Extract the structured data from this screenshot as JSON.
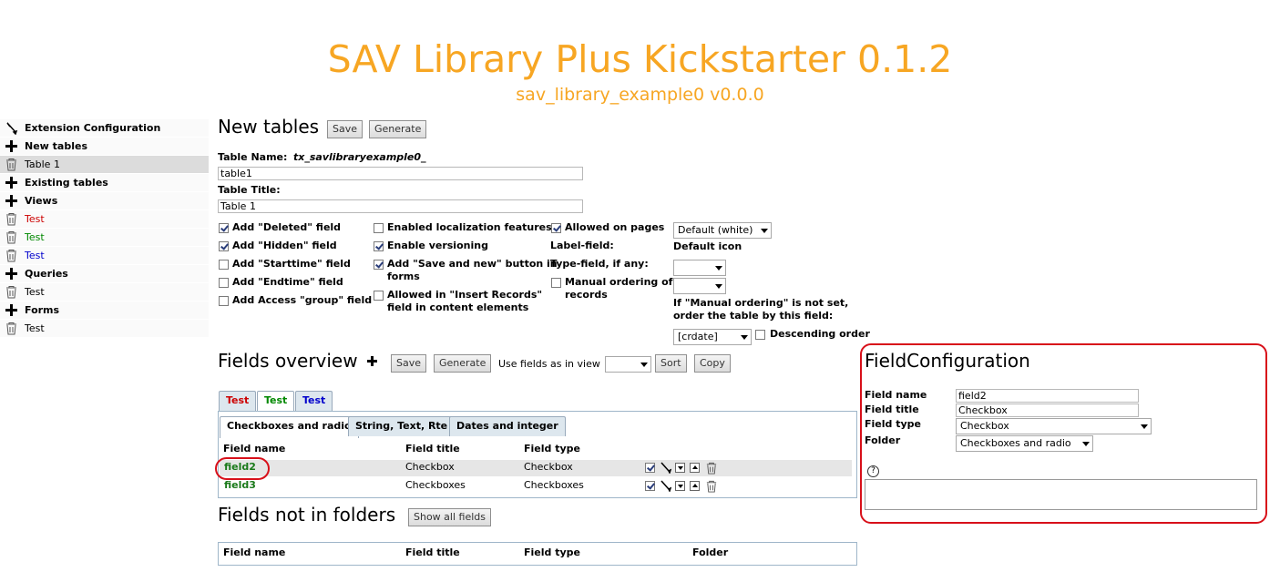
{
  "header": {
    "title": "SAV Library Plus Kickstarter 0.1.2",
    "subtitle": "sav_library_example0 v0.0.0"
  },
  "sidebar": {
    "items": [
      {
        "label": "Extension Configuration",
        "icon": "edit-icon"
      },
      {
        "label": "New tables",
        "icon": "plus-icon"
      },
      {
        "label": "Table 1",
        "icon": "trash-icon"
      },
      {
        "label": "Existing tables",
        "icon": "plus-icon"
      },
      {
        "label": "Views",
        "icon": "plus-icon"
      },
      {
        "label": "Test",
        "icon": "trash-icon",
        "color": "#cc0000"
      },
      {
        "label": "Test",
        "icon": "trash-icon",
        "color": "#008800"
      },
      {
        "label": "Test",
        "icon": "trash-icon",
        "color": "#0000cc"
      },
      {
        "label": "Queries",
        "icon": "plus-icon"
      },
      {
        "label": "Test",
        "icon": "trash-icon"
      },
      {
        "label": "Forms",
        "icon": "plus-icon"
      },
      {
        "label": "Test",
        "icon": "trash-icon"
      }
    ]
  },
  "new_tables": {
    "heading": "New tables",
    "save_label": "Save",
    "generate_label": "Generate",
    "table_name_label": "Table Name:",
    "table_name_prefix": "tx_savlibraryexample0_",
    "table_name_value": "table1",
    "table_title_label": "Table Title:",
    "table_title_value": "Table 1",
    "options_col1": [
      {
        "label": "Add \"Deleted\" field",
        "checked": true
      },
      {
        "label": "Add \"Hidden\" field",
        "checked": true
      },
      {
        "label": "Add \"Starttime\" field",
        "checked": false
      },
      {
        "label": "Add \"Endtime\" field",
        "checked": false
      },
      {
        "label": "Add Access \"group\" field",
        "checked": false
      }
    ],
    "options_col2": [
      {
        "label": "Enabled localization features",
        "checked": false
      },
      {
        "label": "Enable versioning",
        "checked": true
      },
      {
        "label": "Add \"Save and new\" button in",
        "label2": "forms",
        "checked": true
      },
      {
        "label": "Allowed in \"Insert Records\"",
        "label2": "field in content elements",
        "checked": false
      }
    ],
    "allowed_on_pages_label": "Allowed on pages",
    "label_field_label": "Label-field:",
    "type_field_label": "Type-field, if any:",
    "manual_ordering_label": "Manual ordering of",
    "manual_ordering_label2": "records",
    "page_type_select": "Default (white)",
    "default_icon_label": "Default icon",
    "ordering_note_1": "If \"Manual ordering\" is not set,",
    "ordering_note_2": "order the table by this field:",
    "order_field_select": "[crdate]",
    "descending_label": "Descending order"
  },
  "fields_overview": {
    "heading": "Fields overview",
    "save_label": "Save",
    "generate_label": "Generate",
    "use_fields_label": "Use fields as in view",
    "use_fields_select": "",
    "sort_label": "Sort",
    "copy_label": "Copy",
    "view_tabs": [
      {
        "label": "Test",
        "color": "#cc0000"
      },
      {
        "label": "Test",
        "color": "#008800"
      },
      {
        "label": "Test",
        "color": "#0000cc"
      }
    ],
    "folder_tabs": [
      {
        "label": "Checkboxes and radio"
      },
      {
        "label": "String, Text, Rte"
      },
      {
        "label": "Dates and integer"
      }
    ],
    "columns": {
      "name": "Field name",
      "title": "Field title",
      "type": "Field type"
    },
    "rows": [
      {
        "name": "field2",
        "title": "Checkbox",
        "type": "Checkbox"
      },
      {
        "name": "field3",
        "title": "Checkboxes",
        "type": "Checkboxes"
      }
    ]
  },
  "fields_not_in_folders": {
    "heading": "Fields not in folders",
    "show_all_label": "Show all fields",
    "columns": {
      "name": "Field name",
      "title": "Field title",
      "type": "Field type",
      "folder": "Folder"
    }
  },
  "field_configuration": {
    "heading": "FieldConfiguration",
    "name_label": "Field name",
    "name_value": "field2",
    "title_label": "Field title",
    "title_value": "Checkbox",
    "type_label": "Field type",
    "type_value": "Checkbox",
    "folder_label": "Folder",
    "folder_value": "Checkboxes and radio",
    "help_icon": "?"
  },
  "colors": {
    "accent": "#f7a623",
    "highlight_ring": "#d8101a",
    "field_link": "#1a7a1a"
  }
}
